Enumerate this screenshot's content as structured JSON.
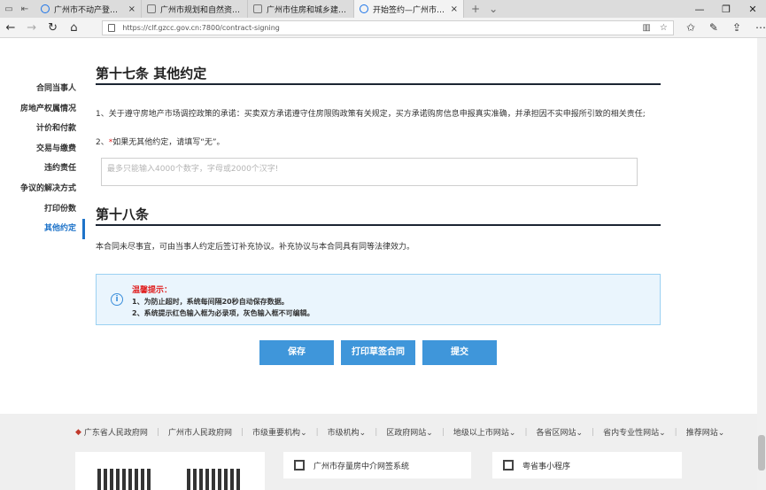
{
  "browser": {
    "tabs": [
      {
        "title": "广州市不动产登记中心_百度",
        "active": false
      },
      {
        "title": "广州市规划和自然资源局网",
        "active": false
      },
      {
        "title": "广州市住房和城乡建设局",
        "active": false
      },
      {
        "title": "开始签约—广州市存量房",
        "active": true
      }
    ],
    "new_tab": "+",
    "url": "https://clf.gzcc.gov.cn:7800/contract-signing"
  },
  "sidebar": {
    "items": [
      {
        "label": "合同当事人",
        "active": false
      },
      {
        "label": "房地产权属情况",
        "active": false
      },
      {
        "label": "计价和付款",
        "active": false
      },
      {
        "label": "交易与缴费",
        "active": false
      },
      {
        "label": "违约责任",
        "active": false
      },
      {
        "label": "争议的解决方式",
        "active": false
      },
      {
        "label": "打印份数",
        "active": false
      },
      {
        "label": "其他约定",
        "active": true
      }
    ]
  },
  "section17": {
    "title": "第十七条 其他约定",
    "item1": "1、关于遵守房地产市场调控政策的承诺：买卖双方承诺遵守住房限购政策有关规定，买方承诺购房信息申报真实准确，并承担因不实申报所引致的相关责任;",
    "item2_prefix": "2、",
    "item2_required": "*",
    "item2_text": "如果无其他约定，请填写“无”。",
    "textarea_placeholder": "最多只能输入4000个数字，字母或2000个汉字!"
  },
  "section18": {
    "title": "第十八条",
    "text": "本合同未尽事宜，可由当事人约定后签订补充协议。补充协议与本合同具有同等法律效力。"
  },
  "notice": {
    "icon": "info-icon",
    "title": "温馨提示：",
    "lines": [
      "1、为防止超时，系统每间隔20秒自动保存数据。",
      "2、系统提示红色输入框为必录项，灰色输入框不可编辑。"
    ]
  },
  "actions": {
    "save": "保存",
    "print": "打印草签合同",
    "submit": "提交"
  },
  "footer": {
    "links": [
      "广东省人民政府网",
      "广州市人民政府网",
      "市级重要机构",
      "市级机构",
      "区政府网站",
      "地级以上市网站",
      "各省区网站",
      "省内专业性网站",
      "推荐网站"
    ],
    "cards": [
      "广州市存量房中介网签系统",
      "粤省事小程序"
    ]
  },
  "colors": {
    "accent": "#3f96da",
    "required": "#e02020",
    "notice_bg": "#eaf5fd",
    "sidebar_active": "#1e73c9"
  }
}
